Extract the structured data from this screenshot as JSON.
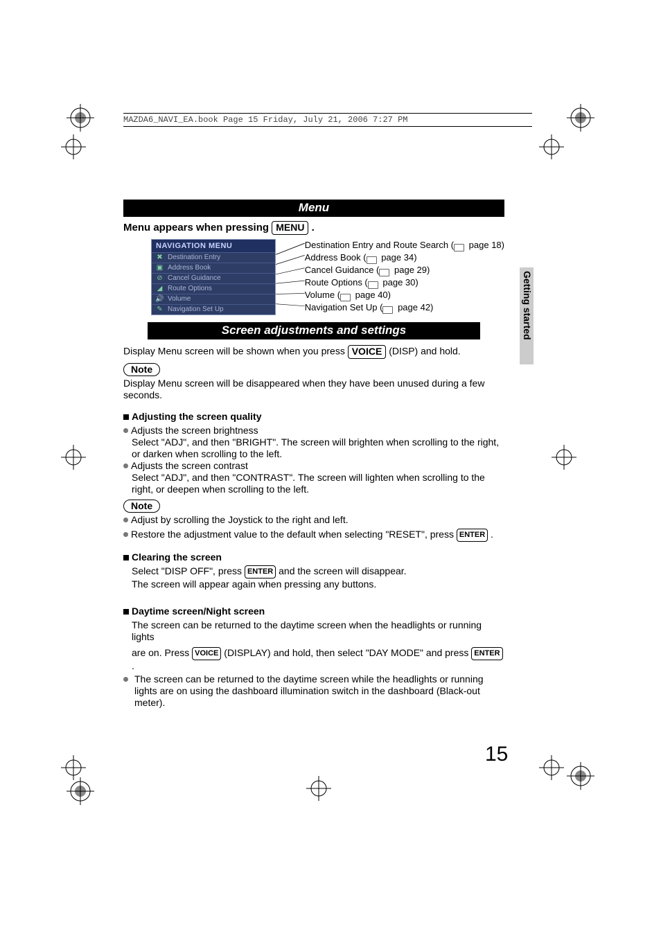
{
  "header_meta": "MAZDA6_NAVI_EA.book  Page 15  Friday, July 21, 2006  7:27 PM",
  "side_tab": "Getting started",
  "page_number": "15",
  "menu": {
    "title": "Menu",
    "subline_prefix": "Menu appears when pressing ",
    "subline_button": "MENU",
    "subline_suffix": " .",
    "nav_title": "NAVIGATION MENU",
    "items": [
      {
        "label": "Destination Entry"
      },
      {
        "label": "Address Book"
      },
      {
        "label": "Cancel Guidance"
      },
      {
        "label": "Route Options"
      },
      {
        "label": "Volume"
      },
      {
        "label": "Navigation Set Up"
      }
    ],
    "callouts": [
      {
        "text": "Destination Entry and Route Search (",
        "page": " page 18)"
      },
      {
        "text": "Address Book (",
        "page": " page 34)"
      },
      {
        "text": "Cancel Guidance (",
        "page": " page 29)"
      },
      {
        "text": "Route Options (",
        "page": " page 30)"
      },
      {
        "text": "Volume (",
        "page": " page 40)"
      },
      {
        "text": "Navigation Set Up (",
        "page": " page 42)"
      }
    ]
  },
  "screen": {
    "title": "Screen adjustments and settings",
    "line1_a": "Display Menu screen will be shown when you press ",
    "line1_btn": "VOICE",
    "line1_b": " (DISP) and hold.",
    "note_label": "Note",
    "note_text": "Display Menu screen will be disappeared when they have been unused during a few seconds.",
    "adj_head": "Adjusting the screen quality",
    "adj_b1_title": "Adjusts the screen brightness",
    "adj_b1_text": "Select \"ADJ\", and then \"BRIGHT\". The screen will brighten when scrolling to the right, or darken when scrolling to the left.",
    "adj_b2_title": "Adjusts the screen contrast",
    "adj_b2_text": "Select \"ADJ\", and then \"CONTRAST\". The screen will lighten when scrolling to the right, or deepen when scrolling to the left.",
    "note2_b1": "Adjust by scrolling the Joystick to the right and left.",
    "note2_b2_a": "Restore the adjustment value to the default when selecting \"RESET\", press ",
    "note2_b2_btn": "ENTER",
    "note2_b2_b": " .",
    "clear_head": "Clearing the screen",
    "clear_l1_a": "Select \"DISP OFF\", press ",
    "clear_l1_btn": "ENTER",
    "clear_l1_b": " and the screen will disappear.",
    "clear_l2": "The screen will appear again when pressing any buttons.",
    "day_head": "Daytime screen/Night screen",
    "day_l1": "The screen can be returned to the daytime screen when the headlights or running lights",
    "day_l2_a": "are on. Press ",
    "day_l2_btn1": "VOICE",
    "day_l2_b": " (DISPLAY) and hold, then select \"DAY MODE\" and press ",
    "day_l2_btn2": "ENTER",
    "day_l2_c": " .",
    "day_b1": "The screen can be returned to the daytime screen while the headlights or running lights are on using the dashboard illumination switch in the dashboard (Black-out meter)."
  }
}
